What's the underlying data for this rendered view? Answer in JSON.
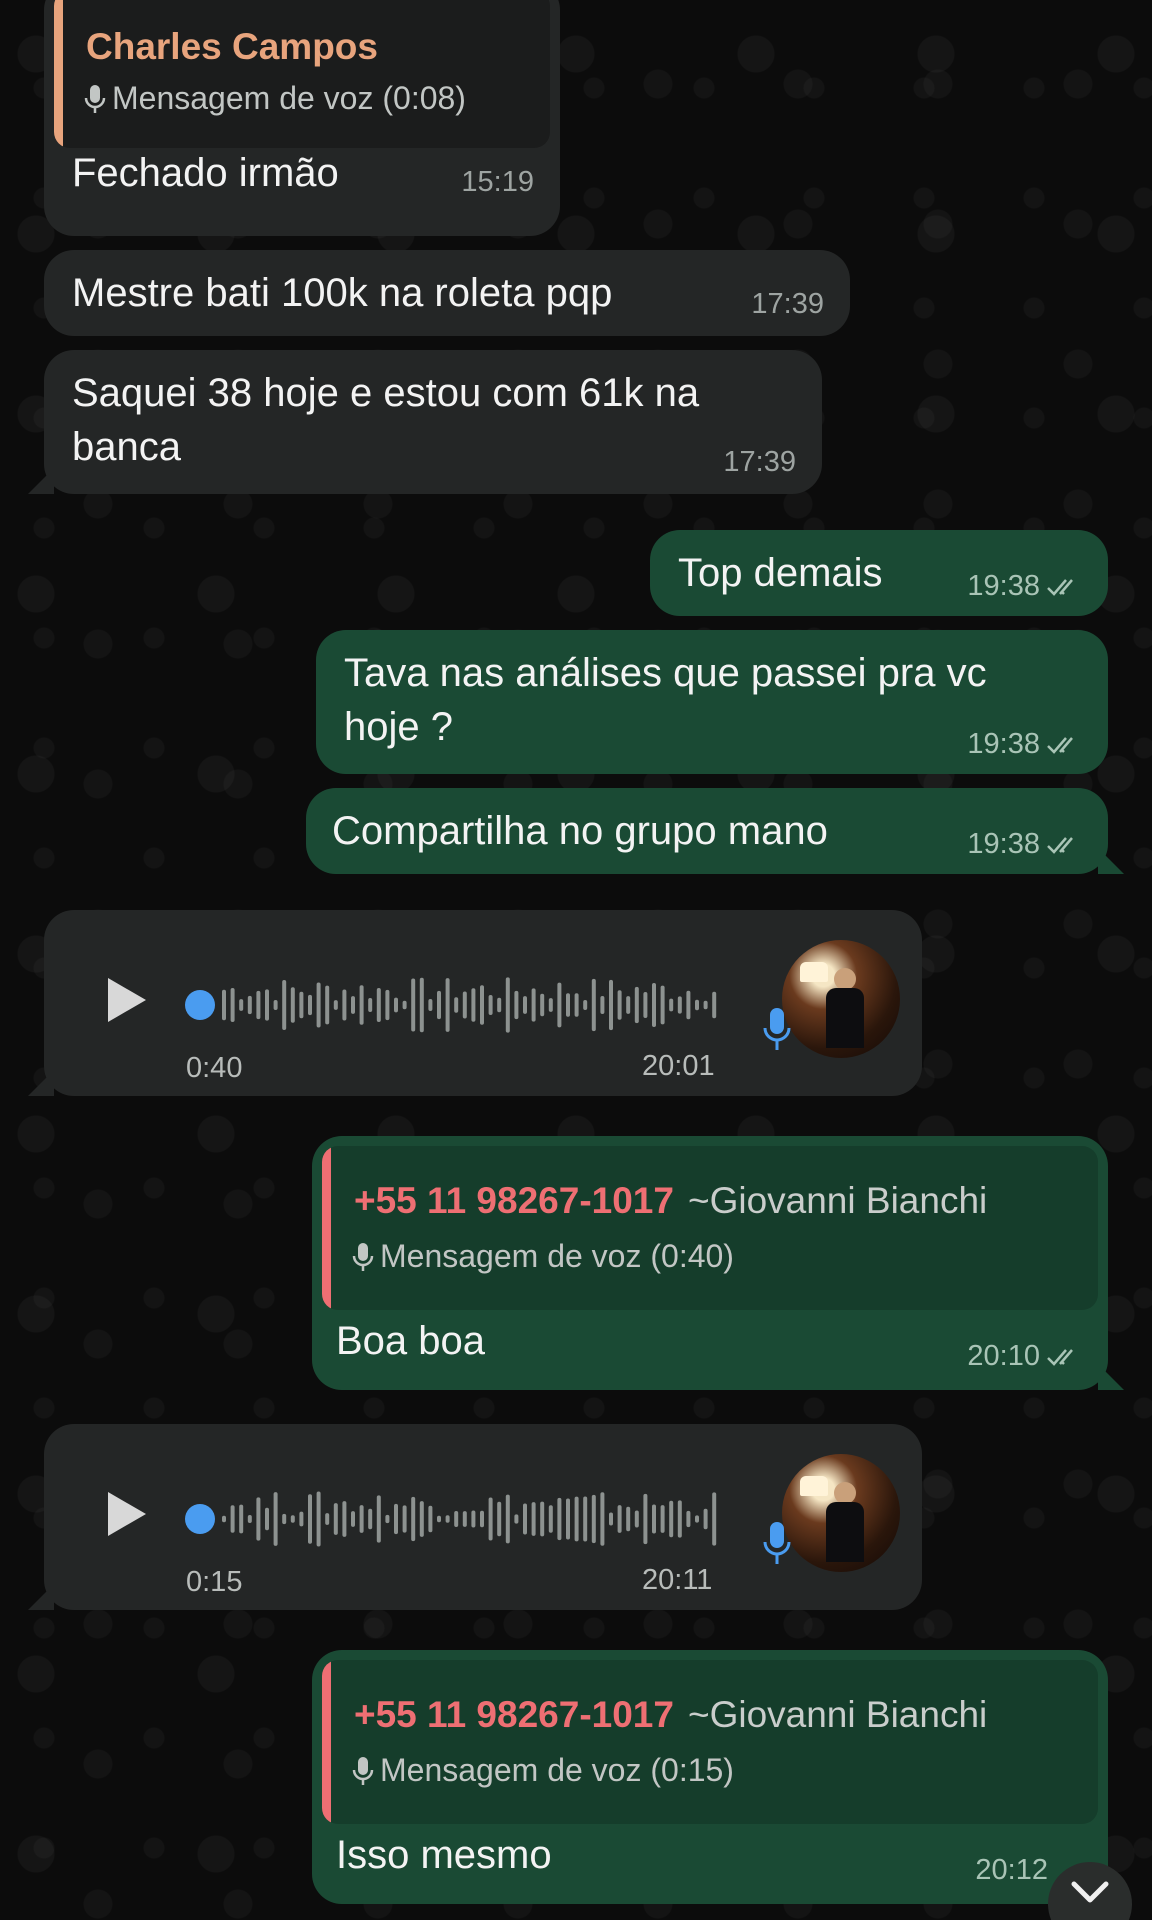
{
  "colors": {
    "incoming_bubble": "#242626",
    "outgoing_bubble": "#1a4a34",
    "quote_name_charles": "#e8a47d",
    "quote_name_phone": "#ee6f73",
    "audio_dot": "#4a9cf0"
  },
  "messages": [
    {
      "quote": {
        "name": "Charles  Campos",
        "text": "Mensagem de voz (0:08)",
        "icon": "mic-icon"
      },
      "text": "Fechado irmão",
      "time": "15:19"
    },
    {
      "text": "Mestre bati 100k na roleta pqp",
      "time": "17:39"
    },
    {
      "text_line1": "Saquei 38 hoje e estou com 61k na",
      "text_line2": "banca",
      "time": "17:39"
    },
    {
      "text": "Top demais",
      "time": "19:38",
      "status": "read"
    },
    {
      "text_line1": "Tava nas análises que passei pra vc",
      "text_line2": "hoje ?",
      "time": "19:38",
      "status": "read"
    },
    {
      "text": "Compartilha no grupo mano",
      "time": "19:38",
      "status": "read"
    },
    {
      "type": "voice",
      "duration": "0:40",
      "time": "20:01"
    },
    {
      "quote": {
        "name": "+55 11 98267-1017",
        "extra": "~Giovanni Bianchi",
        "text": "Mensagem de voz (0:40)",
        "icon": "mic-icon"
      },
      "text": "Boa boa",
      "time": "20:10",
      "status": "read"
    },
    {
      "type": "voice",
      "duration": "0:15",
      "time": "20:11"
    },
    {
      "quote": {
        "name": "+55 11 98267-1017",
        "extra": "~Giovanni Bianchi",
        "text": "Mensagem de voz (0:15)",
        "icon": "mic-icon"
      },
      "text": "Isso mesmo",
      "time": "20:12",
      "status": "read"
    }
  ],
  "scroll_button": {
    "icon": "chevron-down-icon"
  }
}
